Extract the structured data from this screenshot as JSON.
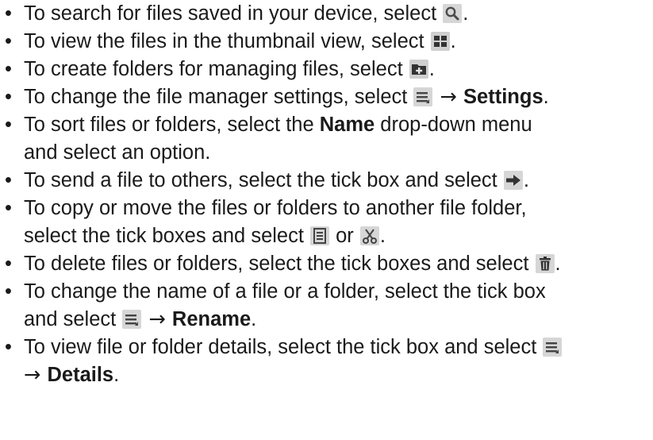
{
  "items": [
    {
      "t1": "To search for files saved in your device, select ",
      "t2": "."
    },
    {
      "t1": "To view the files in the thumbnail view, select ",
      "t2": "."
    },
    {
      "t1": "To create folders for managing files, select ",
      "t2": "."
    },
    {
      "t1": "To change the file manager settings, select ",
      "arrow": " → ",
      "bold": "Settings",
      "t2": "."
    },
    {
      "t1": "To sort files or folders, select the ",
      "bold": "Name",
      "t2": " drop-down menu",
      "t3": "and select an option."
    },
    {
      "t1": "To send a file to others, select the tick box and select ",
      "t2": "."
    },
    {
      "t1": "To copy or move the files or folders to another file folder,",
      "t2": "select the tick boxes and select ",
      "or": " or ",
      "t3": "."
    },
    {
      "t1": "To delete files or folders, select the tick boxes and select ",
      "t2": "."
    },
    {
      "t1": "To change the name of a file or a folder, select the tick box",
      "t2": "and select ",
      "arrow": " → ",
      "bold": "Rename",
      "t3": "."
    },
    {
      "t1": "To view file or folder details, select the tick box and select ",
      "arrow": "→ ",
      "bold": "Details",
      "t2": "."
    }
  ],
  "bullet": "•",
  "icons": [
    "search-icon",
    "thumbnail-view-icon",
    "create-folder-icon",
    "menu-icon",
    "send-arrow-icon",
    "copy-icon",
    "cut-scissors-icon",
    "delete-trash-icon"
  ]
}
